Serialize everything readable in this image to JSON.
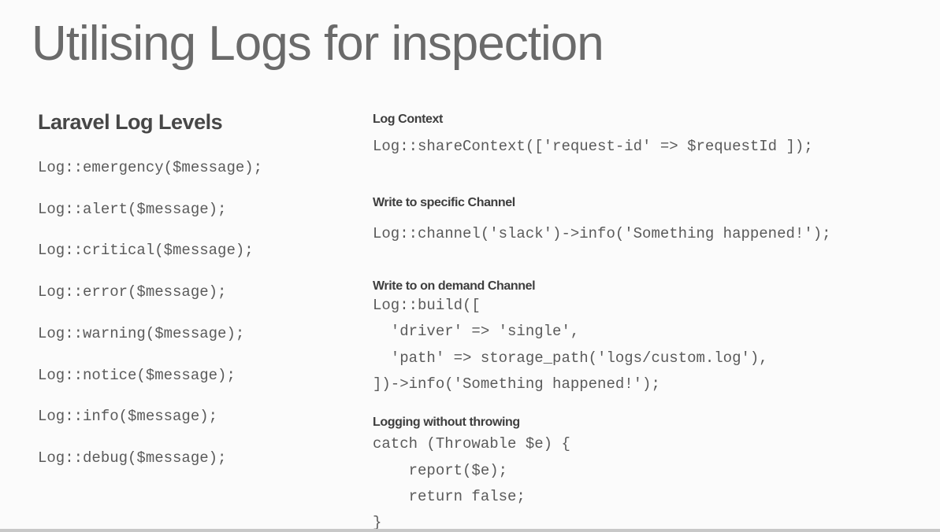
{
  "title": "Utilising Logs for inspection",
  "left": {
    "heading": "Laravel Log Levels",
    "lines": [
      "Log::emergency($message);",
      "Log::alert($message);",
      "Log::critical($message);",
      "Log::error($message);",
      "Log::warning($message);",
      "Log::notice($message);",
      "Log::info($message);",
      "Log::debug($message);"
    ]
  },
  "right": {
    "sections": [
      {
        "heading": "Log Context",
        "lines": [
          "Log::shareContext(['request-id' => $requestId ]);"
        ]
      },
      {
        "heading": "Write to specific Channel",
        "lines": [
          "Log::channel('slack')->info('Something happened!');"
        ]
      },
      {
        "heading": "Write to on demand Channel",
        "lines": [
          "Log::build([",
          "  'driver' => 'single',",
          "  'path' => storage_path('logs/custom.log'),",
          "])->info('Something happened!');"
        ]
      },
      {
        "heading": "Logging without throwing",
        "lines": [
          "catch (Throwable $e) {",
          "    report($e);",
          "    return false;",
          "}"
        ]
      }
    ]
  }
}
